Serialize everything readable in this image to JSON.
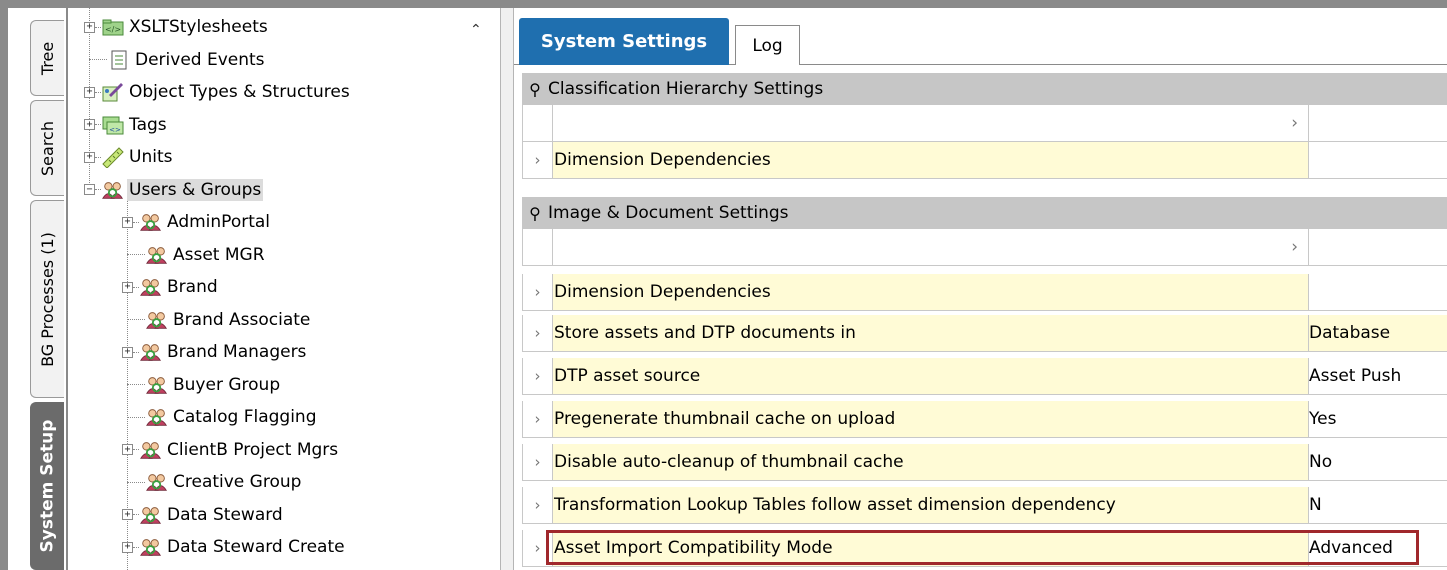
{
  "vertical_tabs": [
    {
      "label": "Tree",
      "active": false
    },
    {
      "label": "Search",
      "active": false
    },
    {
      "label": "BG Processes (1)",
      "active": false
    },
    {
      "label": "System Setup",
      "active": true
    }
  ],
  "tree": {
    "items": [
      {
        "label": "XSLTStylesheets",
        "icon": "folder-xslt-icon",
        "expander": "+",
        "level": 0
      },
      {
        "label": "Derived Events",
        "icon": "document-list-icon",
        "expander": "",
        "level": 0
      },
      {
        "label": "Object Types & Structures",
        "icon": "object-types-icon",
        "expander": "+",
        "level": 0
      },
      {
        "label": "Tags",
        "icon": "tags-icon",
        "expander": "+",
        "level": 0
      },
      {
        "label": "Units",
        "icon": "ruler-icon",
        "expander": "+",
        "level": 0
      },
      {
        "label": "Users & Groups",
        "icon": "users-groups-icon",
        "expander": "−",
        "level": 0,
        "selected": true
      },
      {
        "label": "AdminPortal",
        "icon": "users-groups-icon",
        "expander": "+",
        "level": 1
      },
      {
        "label": "Asset MGR",
        "icon": "users-groups-icon",
        "expander": "",
        "level": 1
      },
      {
        "label": "Brand",
        "icon": "users-groups-icon",
        "expander": "+",
        "level": 1
      },
      {
        "label": "Brand Associate",
        "icon": "users-groups-icon",
        "expander": "",
        "level": 1
      },
      {
        "label": "Brand Managers",
        "icon": "users-groups-icon",
        "expander": "+",
        "level": 1
      },
      {
        "label": "Buyer Group",
        "icon": "users-groups-icon",
        "expander": "",
        "level": 1
      },
      {
        "label": "Catalog Flagging",
        "icon": "users-groups-icon",
        "expander": "",
        "level": 1
      },
      {
        "label": "ClientB Project Mgrs",
        "icon": "users-groups-icon",
        "expander": "+",
        "level": 1
      },
      {
        "label": "Creative Group",
        "icon": "users-groups-icon",
        "expander": "",
        "level": 1
      },
      {
        "label": "Data Steward",
        "icon": "users-groups-icon",
        "expander": "+",
        "level": 1
      },
      {
        "label": "Data Steward Create",
        "icon": "users-groups-icon",
        "expander": "+",
        "level": 1
      }
    ]
  },
  "tabs": {
    "system_settings": "System Settings",
    "log": "Log"
  },
  "sections": [
    {
      "title": "Classification Hierarchy Settings",
      "rows": [
        {
          "name": "",
          "value": "",
          "blank": true
        },
        {
          "name": "Dimension Dependencies",
          "value": ""
        }
      ]
    },
    {
      "title": "Image & Document Settings",
      "rows": [
        {
          "name": "",
          "value": "",
          "blank": true
        },
        {
          "name": "Dimension Dependencies",
          "value": ""
        },
        {
          "name": "Store assets and DTP documents in",
          "value": "Database"
        },
        {
          "name": "DTP asset source",
          "value": "Asset Push"
        },
        {
          "name": "Pregenerate thumbnail cache on upload",
          "value": "Yes"
        },
        {
          "name": "Disable auto-cleanup of thumbnail cache",
          "value": "No"
        },
        {
          "name": "Transformation Lookup Tables follow asset dimension dependency",
          "value": "N"
        },
        {
          "name": "Asset Import Compatibility Mode",
          "value": "Advanced"
        }
      ]
    }
  ],
  "colors": {
    "active_tab": "#1f6faf",
    "section_header": "#c6c6c6",
    "row_highlight": "#fffbd6",
    "selection_outline": "#a0282c"
  }
}
